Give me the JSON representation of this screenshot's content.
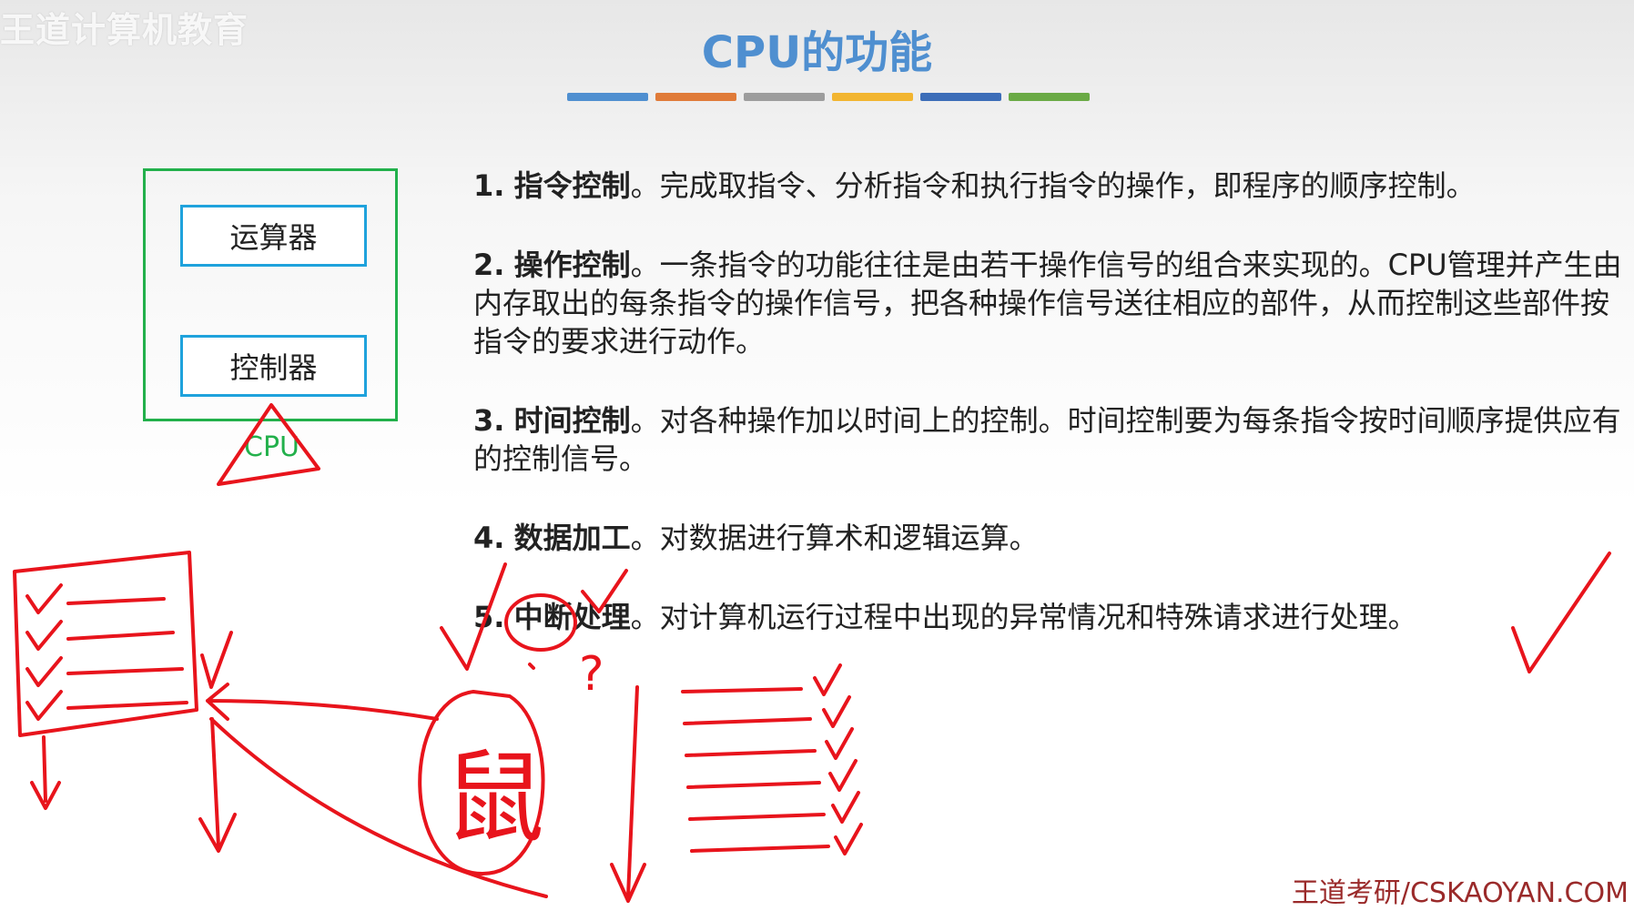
{
  "watermark": "王道计算机教育",
  "title": "CPU的功能",
  "title_bar_colors": [
    "#4f8fd0",
    "#e07b39",
    "#9d9d9d",
    "#f2b530",
    "#3c6db8",
    "#6aaa45"
  ],
  "diagram": {
    "alu_label": "运算器",
    "cu_label": "控制器",
    "cpu_label": "CPU"
  },
  "points": [
    {
      "num": "1.",
      "heading": "指令控制",
      "text": "。完成取指令、分析指令和执行指令的操作，即程序的顺序控制。"
    },
    {
      "num": "2.",
      "heading": "操作控制",
      "text": "。一条指令的功能往往是由若干操作信号的组合来实现的。CPU管理并产生由内存取出的每条指令的操作信号，把各种操作信号送往相应的部件，从而控制这些部件按指令的要求进行动作。"
    },
    {
      "num": "3.",
      "heading": "时间控制",
      "text": "。对各种操作加以时间上的控制。时间控制要为每条指令按时间顺序提供应有的控制信号。"
    },
    {
      "num": "4.",
      "heading": "数据加工",
      "text": "。对数据进行算术和逻辑运算。"
    },
    {
      "num": "5.",
      "heading": "中断处理",
      "text": "。对计算机运行过程中出现的异常情况和特殊请求进行处理。"
    }
  ],
  "annotations": {
    "mouse_char": "鼠",
    "question_mark": "?",
    "ink_color": "#e8141c"
  },
  "footer": "王道考研/CSKAOYAN.COM"
}
